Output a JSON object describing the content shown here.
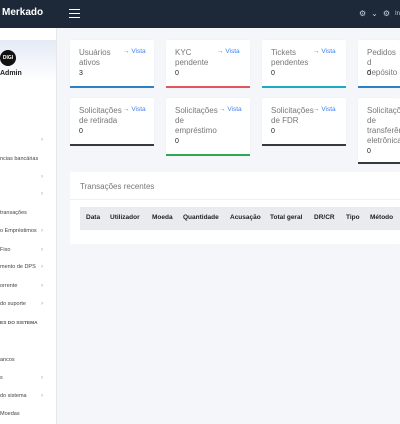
{
  "header": {
    "brand": "Merkado",
    "right_icons": [
      "language-icon",
      "chevron-down-icon",
      "user-icon"
    ],
    "right_text": "In"
  },
  "sidebar": {
    "logo_text": "DIGI",
    "role": "Admin",
    "items": [
      {
        "label": "",
        "chevron": "›"
      },
      {
        "label": "ncias bancárias",
        "chevron": ""
      },
      {
        "label": "",
        "chevron": "›"
      },
      {
        "label": "",
        "chevron": "›"
      },
      {
        "label": "transações",
        "chevron": ""
      },
      {
        "label": "o Empréstimos",
        "chevron": "›"
      },
      {
        "label": "Fixo",
        "chevron": "›"
      },
      {
        "label": "mento de DPS",
        "chevron": "›"
      },
      {
        "label": "orrente",
        "chevron": "›"
      },
      {
        "label": "do suporte",
        "chevron": "›"
      },
      {
        "label": "ancos",
        "chevron": ""
      },
      {
        "label": "s",
        "chevron": "›"
      },
      {
        "label": "do sistema",
        "chevron": "›"
      },
      {
        "label": "Moedas",
        "chevron": ""
      }
    ],
    "section_heading": "ES DO SISTEMA"
  },
  "cards": [
    {
      "label_lines": [
        "Usuários",
        "ativos"
      ],
      "link": "Vista",
      "value": "3",
      "bar_color": "#2f80c0"
    },
    {
      "label_lines": [
        "KYC",
        "pendente"
      ],
      "link": "Vista",
      "value": "0",
      "bar_color": "#e25563"
    },
    {
      "label_lines": [
        "Tickets",
        "pendentes"
      ],
      "link": "Vista",
      "value": "0",
      "bar_color": "#1faac4"
    },
    {
      "label_lines": [
        "Pedidos d",
        "depósito"
      ],
      "link": "",
      "value": "0",
      "bar_color": "#2f80c0"
    },
    {
      "label_lines": [
        "Solicitações",
        "de retirada"
      ],
      "link": "Vista",
      "value": "0",
      "bar_color": "#343a40"
    },
    {
      "label_lines": [
        "Solicitações",
        "de",
        "empréstimo"
      ],
      "link": "Vista",
      "value": "0",
      "bar_color": "#2fa757"
    },
    {
      "label_lines": [
        "Solicitações",
        "de FDR"
      ],
      "link": "Vista",
      "value": "0",
      "bar_color": "#343a40"
    },
    {
      "label_lines": [
        "Solicitaçõe",
        "de",
        "transferênc",
        "eletrônica"
      ],
      "link": "",
      "value": "0",
      "bar_color": "#343a40"
    }
  ],
  "link_arrow": "→",
  "transactions": {
    "title": "Transações recentes",
    "columns": [
      "Data",
      "Utilizador",
      "Moeda",
      "Quantidade",
      "Acusação",
      "Total geral",
      "DR/CR",
      "Tipo",
      "Método"
    ]
  }
}
